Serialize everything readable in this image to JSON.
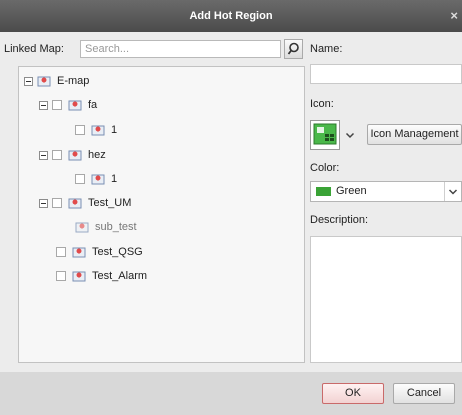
{
  "window": {
    "title": "Add Hot Region",
    "close_glyph": "×"
  },
  "linked_map": {
    "label": "Linked Map:",
    "search_placeholder": "Search..."
  },
  "tree": [
    {
      "label": "E-map",
      "muted": false
    },
    {
      "label": "fa",
      "muted": false
    },
    {
      "label": "1",
      "muted": false
    },
    {
      "label": "hez",
      "muted": false
    },
    {
      "label": "1",
      "muted": false
    },
    {
      "label": "Test_UM",
      "muted": false
    },
    {
      "label": "sub_test",
      "muted": true
    },
    {
      "label": "Test_QSG",
      "muted": false
    },
    {
      "label": "Test_Alarm",
      "muted": false
    }
  ],
  "form": {
    "name_label": "Name:",
    "name_value": "",
    "icon_label": "Icon:",
    "icon_management": "Icon Management",
    "color_label": "Color:",
    "color_value": "Green",
    "color_hex": "#3aa336",
    "description_label": "Description:",
    "description_value": ""
  },
  "buttons": {
    "ok": "OK",
    "cancel": "Cancel"
  }
}
